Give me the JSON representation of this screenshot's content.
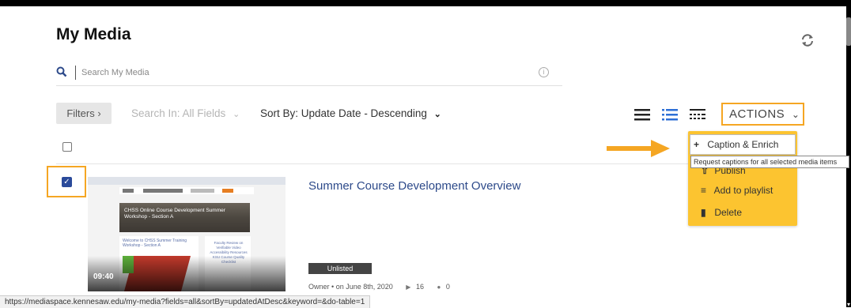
{
  "page": {
    "title": "My Media"
  },
  "search": {
    "placeholder": "Search My Media"
  },
  "toolbar": {
    "filters_label": "Filters",
    "search_in": "Search In: All Fields",
    "sort_by": "Sort By: Update Date - Descending",
    "actions_label": "ACTIONS"
  },
  "actions_menu": {
    "items": [
      {
        "label": "Caption & Enrich",
        "icon": "plus-icon"
      },
      {
        "label": "Publish",
        "icon": "publish-icon"
      },
      {
        "label": "Add to playlist",
        "icon": "playlist-add-icon"
      },
      {
        "label": "Delete",
        "icon": "trash-icon"
      }
    ],
    "tooltip": "Request captions for all selected media items"
  },
  "media_items": [
    {
      "title": "Summer Course Development Overview",
      "duration": "09:40",
      "status": "Unlisted",
      "owner": "Owner",
      "date": "on June 8th, 2020",
      "plays": "16",
      "comments": "0",
      "selected": true,
      "thumbnail": {
        "banner_text": "CHSS Online Course Development Summer Workshop - Section A",
        "panel_text": "Welcome to CHSS Summer Training Workshop - Section A",
        "side_text": "Faculty Review on Verifiable Video Accessibility Resources KSU Course Quality Checklist"
      }
    }
  ],
  "status_bar": {
    "url": "https://mediaspace.kennesaw.edu/my-media?fields=all&sortBy=updatedAtDesc&keyword=&do-table=1"
  },
  "colors": {
    "accent": "#f5a623",
    "menu_bg": "#fcc430",
    "link": "#2d4a8a",
    "selected": "#2a4a9a"
  }
}
